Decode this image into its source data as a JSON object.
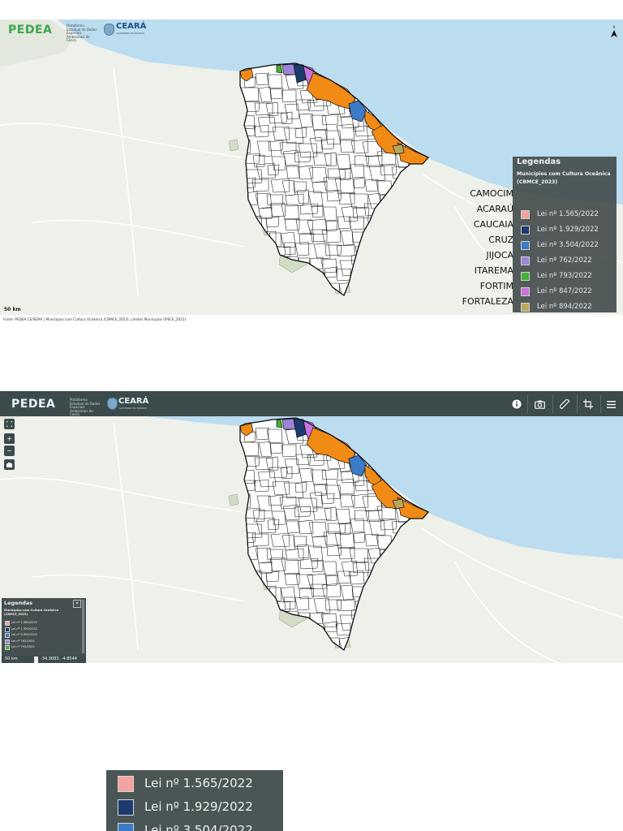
{
  "header": {
    "logo_text": "PEDEA",
    "logo_subtitle": "Plataforma Estadual de Dados Espaciais Ambientais do Ceará",
    "state_logo_text": "CEARÁ",
    "state_logo_subtitle": "GOVERNO DO ESTADO"
  },
  "map": {
    "north_label": "N",
    "scale_bar_label": "50 km",
    "source_caption": "Fonte: PEDEA CE/SEMA | Municípios com Cultura Oceânica (CBMCE_2023), Limites Municipais (IPECE_2021)",
    "cursor_coordinates": "-34.3083, -4.8544",
    "colors": {
      "ocean": "#bcdcef",
      "land": "#eef0ea",
      "boundary": "#111111",
      "state_fill": "#ffffff",
      "protected_area": "#d3dcc7"
    }
  },
  "legend": {
    "title": "Legendas",
    "layer_name": "Municípios com Cultura Oceânica (CBMCE_2023)",
    "items": [
      {
        "label": "Lei nº 1.565/2022",
        "color": "#f4a3a0",
        "city": "CAMOCIM"
      },
      {
        "label": "Lei nº 1.929/2022",
        "color": "#1c3a6e",
        "city": "ACARAÚ"
      },
      {
        "label": "Lei nº 3.504/2022",
        "color": "#3b7bc8",
        "city": "CAUCAIA"
      },
      {
        "label": "Lei nº 762/2022",
        "color": "#9b85d6",
        "city": "CRUZ"
      },
      {
        "label": "Lei nº 793/2022",
        "color": "#46b135",
        "city": "JIJOCA"
      },
      {
        "label": "Lei nº 847/2022",
        "color": "#c974de",
        "city": "ITAREMA"
      },
      {
        "label": "Lei nº 894/2022",
        "color": "#b9a85a",
        "city": "FORTIM"
      },
      {
        "label": "Não possui lei",
        "color": "#f28a16",
        "city": "FORTALEZA"
      }
    ]
  },
  "toolbar": {
    "info_icon": "info-icon",
    "camera_icon": "camera-icon",
    "ruler_icon": "ruler-icon",
    "crop_icon": "crop-icon",
    "menu_icon": "menu-icon"
  },
  "map_controls": {
    "fullscreen_icon": "fullscreen-icon",
    "zoom_in_label": "+",
    "zoom_out_label": "−",
    "layers_icon": "layers-icon"
  },
  "legend_close_label": "×"
}
